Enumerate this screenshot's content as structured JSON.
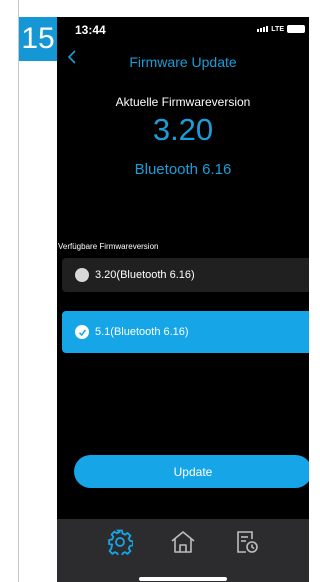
{
  "step_badge": "15",
  "status_bar": {
    "time": "13:44",
    "network": "LTE"
  },
  "nav": {
    "title": "Firmware Update",
    "back_icon": "chevron-left-icon"
  },
  "current": {
    "label": "Aktuelle Firmwareversion",
    "version": "3.20",
    "bluetooth": "Bluetooth 6.16"
  },
  "available": {
    "label": "Verfügbare Firmwareversion",
    "options": [
      {
        "label": "3.20(Bluetooth 6.16)",
        "selected": false
      },
      {
        "label": "5.1(Bluetooth 6.16)",
        "selected": true
      }
    ]
  },
  "update_button": "Update",
  "tabbar": {
    "tabs": [
      {
        "icon": "gear-icon",
        "active": true
      },
      {
        "icon": "home-icon",
        "active": false
      },
      {
        "icon": "history-log-icon",
        "active": false
      }
    ]
  },
  "colors": {
    "accent": "#16a6e8",
    "badge": "#1597d6",
    "background": "#000000",
    "tabbar": "#2c2c2e"
  }
}
